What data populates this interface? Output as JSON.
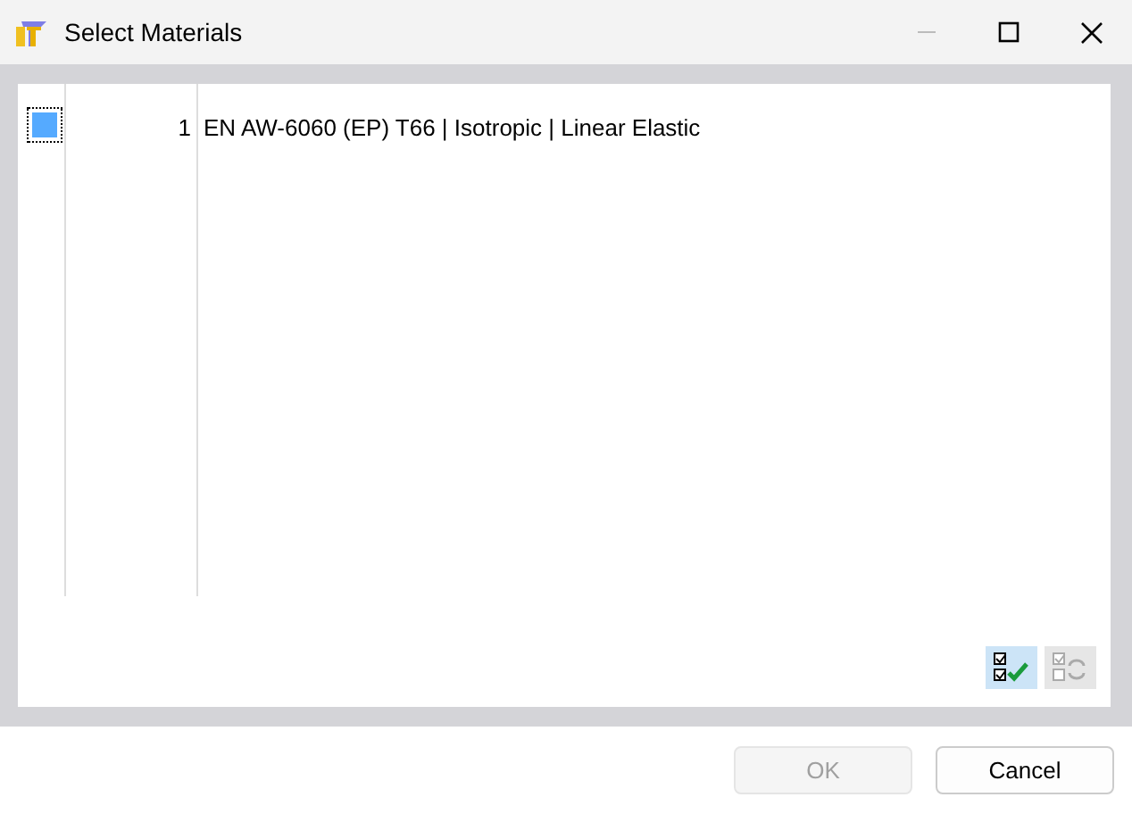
{
  "window": {
    "title": "Select Materials"
  },
  "materials": [
    {
      "number": "1",
      "name": "EN AW-6060 (EP) T66 | Isotropic | Linear Elastic",
      "color": "#55aaff"
    }
  ],
  "tools": [
    {
      "kind": "select-all",
      "highlighted": true,
      "disabled": false
    },
    {
      "kind": "invert",
      "highlighted": false,
      "disabled": true
    }
  ],
  "buttons": [
    {
      "label": "OK",
      "disabled": true
    },
    {
      "label": "Cancel",
      "disabled": false
    }
  ]
}
